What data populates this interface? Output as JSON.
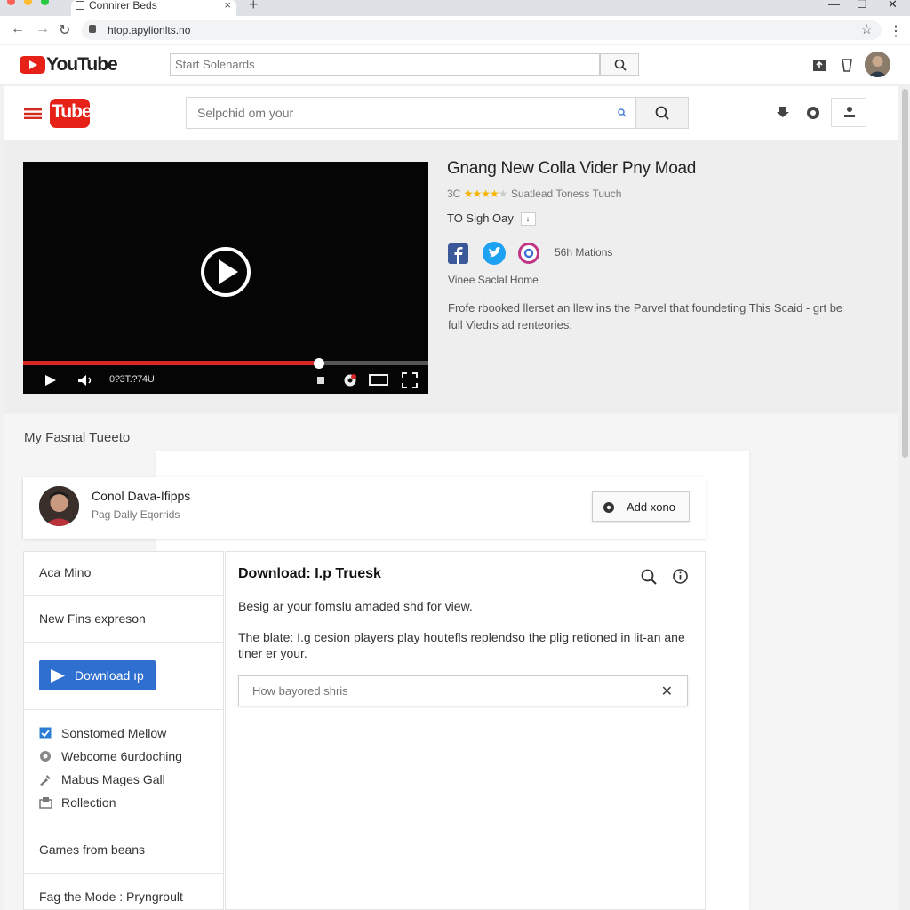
{
  "browser": {
    "tab_title": "Connirer Beds",
    "tab_close": "×",
    "new_tab": "+",
    "url": "htop.apylionlts.no",
    "window_controls": {
      "minimize": "—",
      "maximize": "☐",
      "close": "✕"
    }
  },
  "header1": {
    "logo_text": "YouTube",
    "search_placeholder": "Start Solenards"
  },
  "header2": {
    "logo_text": "Tube",
    "search_placeholder": "Selpchid om your"
  },
  "video": {
    "time": "0?3T.?74U",
    "progress": 0.73
  },
  "info": {
    "title": "Gnang New Colla Vider Pny Moad",
    "rating_prefix": "3C",
    "stars": "★★★★",
    "star_empty": "★",
    "rating_label": "Suatlead Toness Tuuch",
    "channel": "TO Sigh Oay",
    "channel_badge": "↓",
    "views": "56h Mations",
    "social_home": "Vinee Saclal Home",
    "description": "Frofe rbooked llerset an llew ins the Parvel that foundeting This Scaid - grt be full Viedrs ad renteories."
  },
  "lower": {
    "section_title": "My Fasnal Tueeto",
    "user": {
      "name": "Conol Dava-Ifipps",
      "subtitle": "Pag Dally Eqorrids",
      "add_button": "Add xono"
    },
    "left_panel": {
      "item1": "Aca Mino",
      "item2": "New Fins expreson",
      "download_button": "Download ıp",
      "checks": [
        "Sonstomed Mellow",
        "Webcome 6urdoching",
        "Mabus Mages Gall",
        "Rollection"
      ],
      "item3": "Games from beans",
      "item4": "Fag the Mode : Pryngroult"
    },
    "right_panel": {
      "title": "Download: I.p Truesk",
      "text1": "Besig ar your fomslu amaded shd for view.",
      "text2": "The blate: I.g cesion players play houtefls replendso the plig retioned in lit-an ane tiner er your.",
      "input_placeholder": "How bayored shris",
      "clear": "✕"
    }
  },
  "colors": {
    "youtube_red": "#e62117",
    "progress_red": "#d92626",
    "download_blue": "#2f6fd0",
    "facebook": "#3b5998",
    "twitter": "#1da1f2",
    "star": "#f4b400"
  }
}
